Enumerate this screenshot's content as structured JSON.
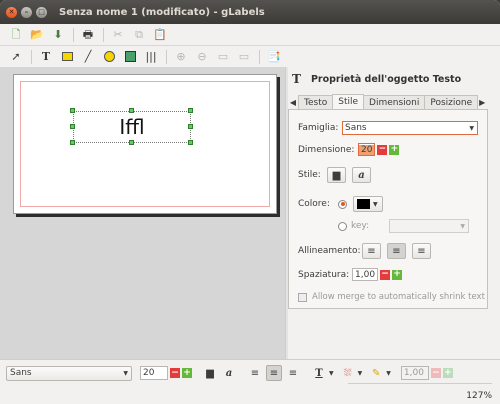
{
  "window": {
    "title": "Senza nome 1 (modificato) - gLabels"
  },
  "canvas": {
    "text": "Iffl"
  },
  "panel": {
    "title_glyph": "T",
    "title": "Proprietà dell'oggetto Testo",
    "tabs": [
      "Testo",
      "Stile",
      "Dimensioni",
      "Posizione"
    ],
    "active_tab": "Stile",
    "famiglia_label": "Famiglia:",
    "famiglia_value": "Sans",
    "dimensione_label": "Dimensione:",
    "dimensione_value": "20",
    "stile_label": "Stile:",
    "colore_label": "Colore:",
    "color_swatch": "#000000",
    "key_label": "key:",
    "allineamento_label": "Allineamento:",
    "spaziatura_label": "Spaziatura:",
    "spaziatura_value": "1,00",
    "merge_label": "Allow merge to automatically shrink text"
  },
  "statusbar": {
    "font_value": "Sans",
    "size_value": "20",
    "spacing_value": "1,00",
    "zoom": "127%"
  },
  "icons": [
    "new-doc-icon",
    "open-folder-icon",
    "save-icon",
    "print-icon",
    "cut-icon",
    "copy-icon",
    "paste-icon",
    "arrow-pointer-icon",
    "text-tool-icon",
    "rect-tool-icon",
    "line-tool-icon",
    "ellipse-tool-icon",
    "image-tool-icon",
    "barcode-tool-icon",
    "zoom-in-icon",
    "zoom-out-icon",
    "zoom-fit-icon",
    "zoom-reset-icon",
    "merge-properties-icon"
  ]
}
